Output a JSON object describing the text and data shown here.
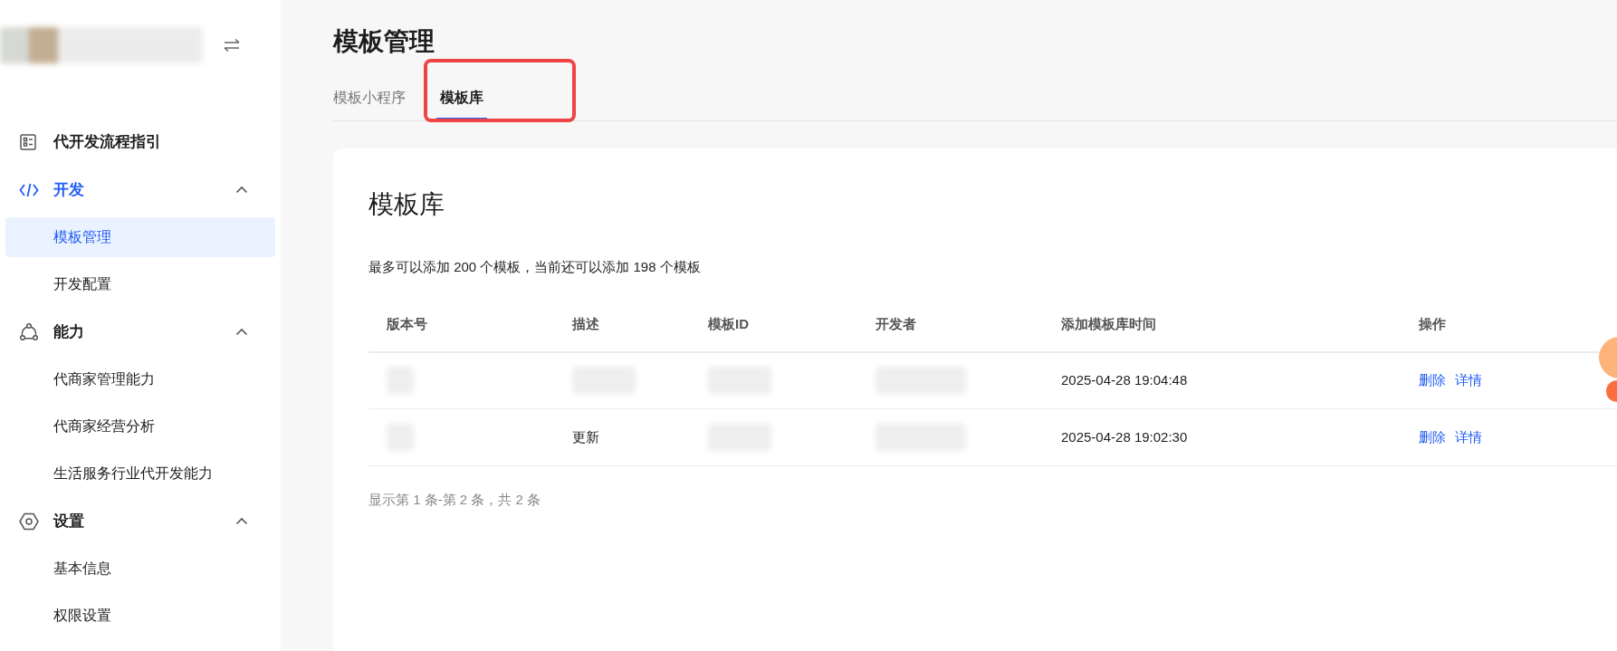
{
  "sidebar": {
    "sections": [
      {
        "label": "代开发流程指引",
        "kind": "guide",
        "active": false
      },
      {
        "label": "开发",
        "kind": "code",
        "active": true,
        "expanded": true,
        "children": [
          {
            "label": "模板管理",
            "selected": true
          },
          {
            "label": "开发配置",
            "selected": false
          }
        ]
      },
      {
        "label": "能力",
        "kind": "network",
        "active": false,
        "expanded": true,
        "children": [
          {
            "label": "代商家管理能力",
            "selected": false
          },
          {
            "label": "代商家经营分析",
            "selected": false
          },
          {
            "label": "生活服务行业代开发能力",
            "selected": false
          }
        ]
      },
      {
        "label": "设置",
        "kind": "settings",
        "active": false,
        "expanded": true,
        "children": [
          {
            "label": "基本信息",
            "selected": false
          },
          {
            "label": "权限设置",
            "selected": false
          }
        ]
      }
    ]
  },
  "page": {
    "title": "模板管理",
    "tabs": [
      {
        "label": "模板小程序",
        "selected": false
      },
      {
        "label": "模板库",
        "selected": true
      }
    ]
  },
  "card": {
    "title": "模板库",
    "note": "最多可以添加 200 个模板，当前还可以添加 198 个模板",
    "table": {
      "columns": [
        "版本号",
        "描述",
        "模板ID",
        "开发者",
        "添加模板库时间",
        "操作"
      ],
      "rows": [
        {
          "cells": [
            {
              "redacted": true
            },
            {
              "redacted": true
            },
            {
              "redacted": true
            },
            {
              "redacted": true
            },
            {
              "text": "2025-04-28 19:04:48"
            }
          ],
          "actions": [
            "删除",
            "详情"
          ]
        },
        {
          "cells": [
            {
              "redacted": true
            },
            {
              "text": "更新"
            },
            {
              "redacted": true
            },
            {
              "redacted": true
            },
            {
              "text": "2025-04-28 19:02:30"
            }
          ],
          "actions": [
            "删除",
            "详情"
          ]
        }
      ]
    },
    "footer": "显示第 1 条-第 2 条，共 2 条"
  }
}
